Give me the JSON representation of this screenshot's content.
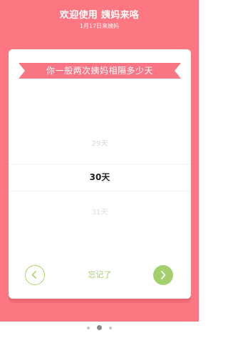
{
  "header": {
    "title": "欢迎使用 姨妈来咯",
    "subtitle": "1月17日来姨妈"
  },
  "question": {
    "text": "你一般两次姨妈相隔多少天"
  },
  "picker": {
    "prev": "29天",
    "current": "30天",
    "next": "31天"
  },
  "actions": {
    "forget_label": "忘记了",
    "prev_icon": "chevron-left-icon",
    "next_icon": "chevron-right-icon"
  },
  "pager": {
    "total": 3,
    "active_index": 1
  },
  "colors": {
    "primary_pink": "#fc7781",
    "ribbon_pink": "#f87684",
    "accent_green": "#a4cf6d",
    "text_dark": "#222222"
  }
}
